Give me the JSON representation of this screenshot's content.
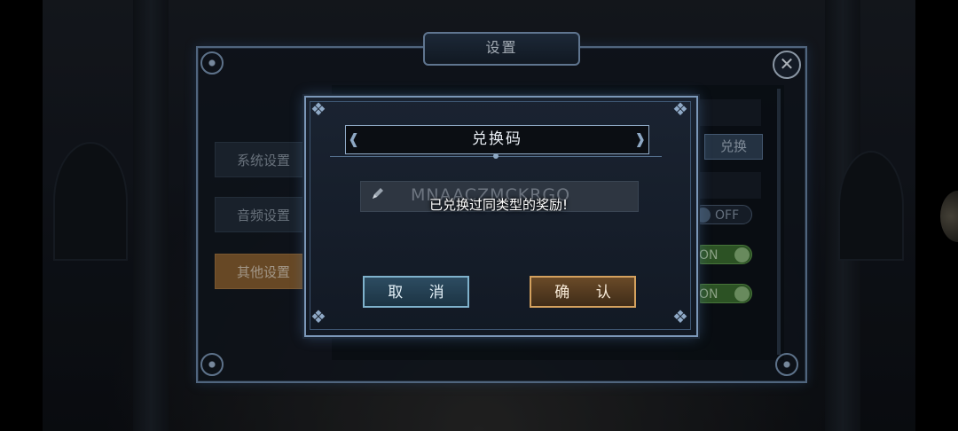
{
  "settings": {
    "title": "设置",
    "close_icon": "close-icon",
    "tabs": [
      {
        "label": "系统设置",
        "active": false
      },
      {
        "label": "音频设置",
        "active": false
      },
      {
        "label": "其他设置",
        "active": true
      }
    ],
    "redeem_button": "兑换",
    "toggles": [
      "OFF",
      "ON",
      "ON"
    ]
  },
  "modal": {
    "title": "兑换码",
    "code_value": "MNAACZMCKRGO",
    "toast": "已兑换过同类型的奖励!",
    "cancel_label": "取 消",
    "confirm_label": "确 认",
    "pencil_icon": "pencil-icon"
  },
  "colors": {
    "frame": "#7b97b8",
    "cancel_border": "#7fb2cc",
    "confirm_border": "#d4a15e",
    "active_tab": "#8a6132",
    "toggle_on": "#3b6e30"
  }
}
